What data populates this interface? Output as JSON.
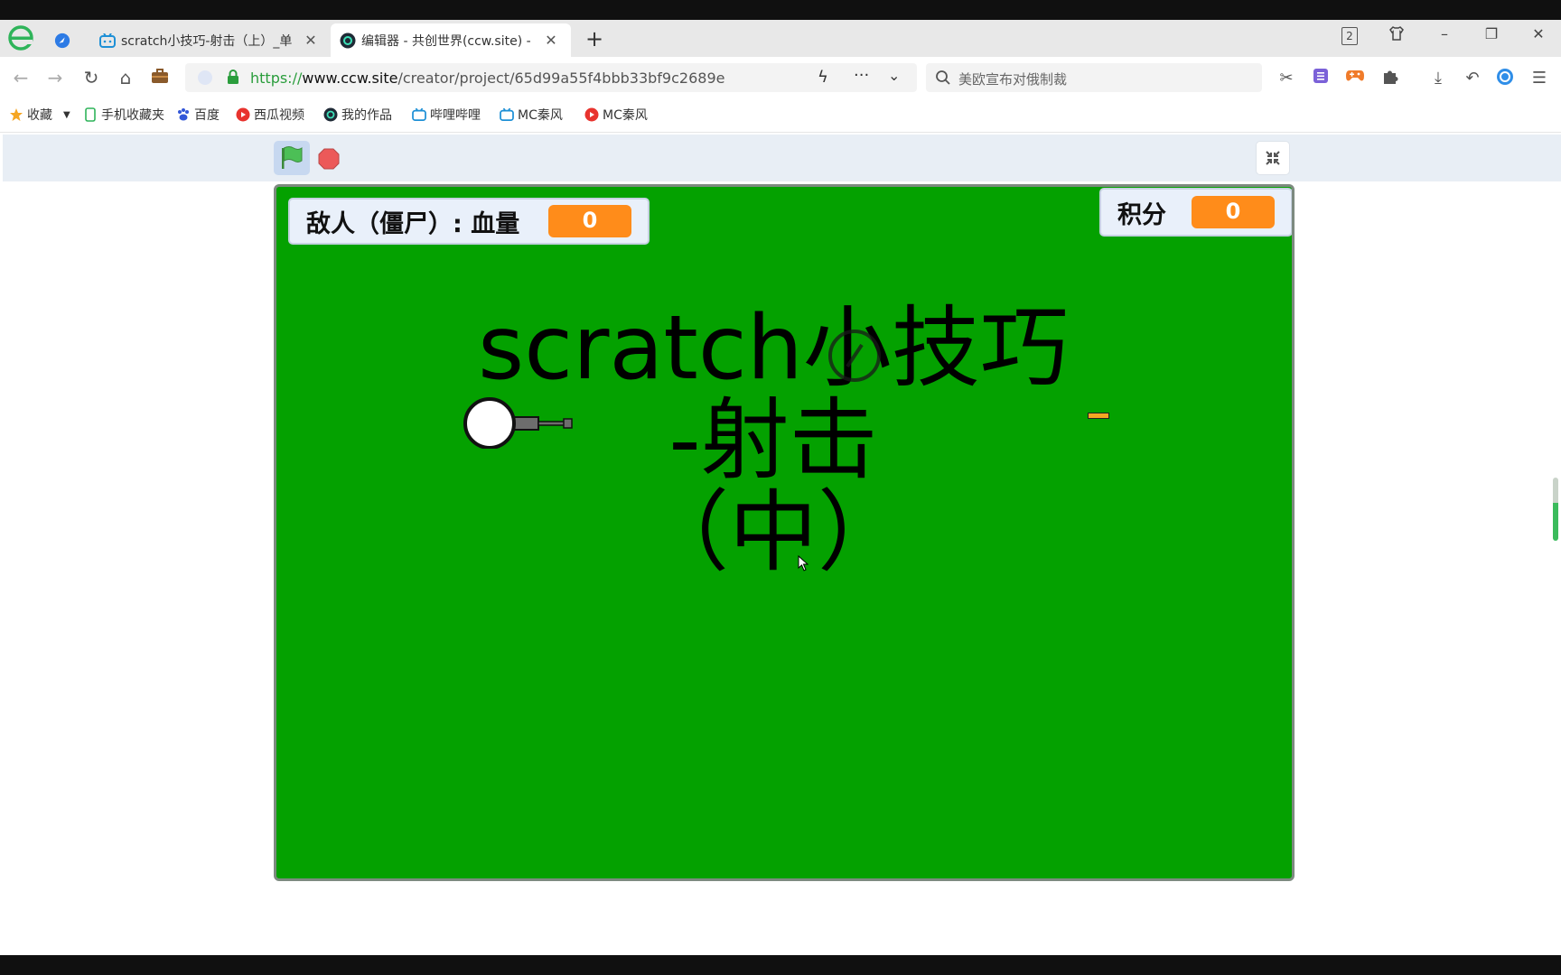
{
  "browser": {
    "tabs": [
      {
        "title": "scratch小技巧-射击（上）_单",
        "active": false
      },
      {
        "title": "编辑器 - 共创世界(ccw.site) -",
        "active": true
      }
    ],
    "tab_count_badge": "2",
    "url": {
      "protocol": "https://",
      "host": "www.ccw.site",
      "path": "/creator/project/65d99a55f4bbb33bf9c2689e"
    },
    "search_placeholder": "美欧宣布对俄制裁",
    "bookmarks": [
      {
        "label": "收藏",
        "icon": "star-icon"
      },
      {
        "label": "手机收藏夹",
        "icon": "phone-icon"
      },
      {
        "label": "百度",
        "icon": "baidu-paw-icon"
      },
      {
        "label": "西瓜视频",
        "icon": "xigua-icon"
      },
      {
        "label": "我的作品",
        "icon": "ccw-icon"
      },
      {
        "label": "哔哩哔哩",
        "icon": "bilibili-icon"
      },
      {
        "label": "MC秦风",
        "icon": "bilibili-icon"
      },
      {
        "label": "MC秦风",
        "icon": "xigua-icon"
      }
    ]
  },
  "stage": {
    "enemy_monitor": {
      "label": "敌人（僵尸）: 血量",
      "value": "0"
    },
    "score_monitor": {
      "label": "积分",
      "value": "0"
    },
    "title_lines": [
      "scratch小技巧",
      "-射击",
      "（中）"
    ],
    "background_color": "#04a100",
    "monitor_value_color": "#ff8c1a"
  }
}
